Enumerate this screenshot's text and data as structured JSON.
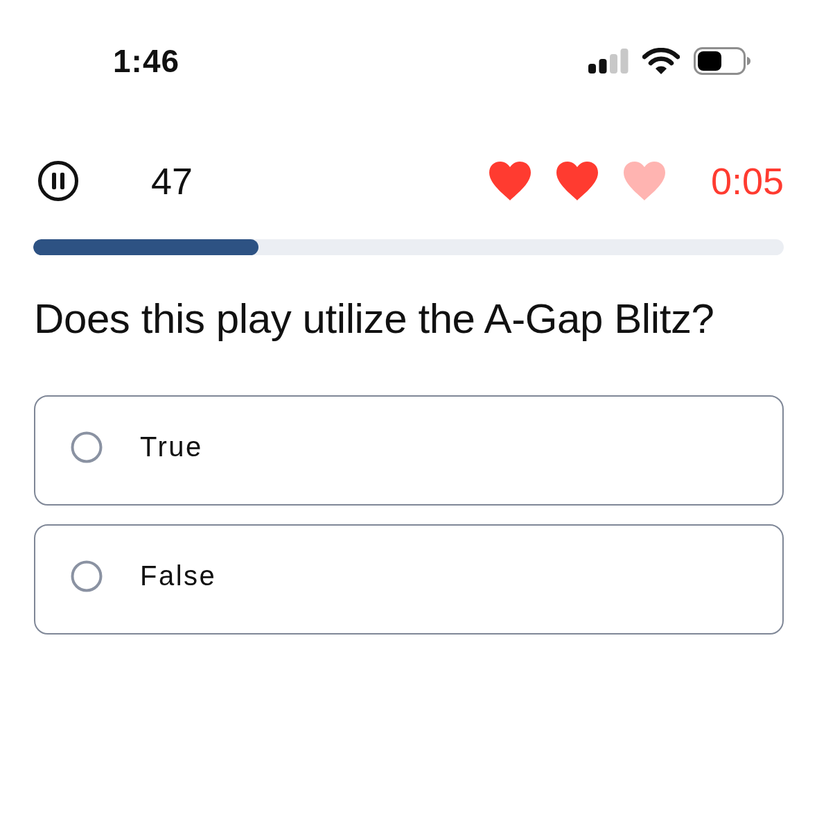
{
  "status_bar": {
    "time": "1:46"
  },
  "header": {
    "score": "47",
    "lives": [
      {
        "lost": false
      },
      {
        "lost": false
      },
      {
        "lost": true
      }
    ],
    "timer": "0:05"
  },
  "progress": {
    "level": 0.3
  },
  "question": "Does this play utilize the A-Gap Blitz?",
  "options": [
    {
      "label": "True",
      "selected": false
    },
    {
      "label": "False",
      "selected": false
    }
  ]
}
